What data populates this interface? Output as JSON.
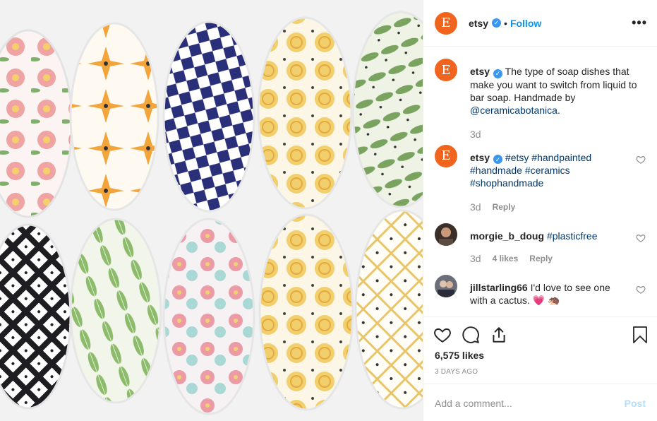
{
  "post": {
    "author": "etsy",
    "avatar_letter": "E",
    "follow_label": "Follow",
    "separator": "•",
    "verified_glyph": "✓"
  },
  "comments": [
    {
      "user": "etsy",
      "avatar_letter": "E",
      "text_plain": "The type of soap dishes that make you want to switch from liquid to bar soap. Handmade by",
      "mention": "@ceramicabotanica",
      "suffix": ".",
      "time": "3d"
    },
    {
      "user": "etsy",
      "avatar_letter": "E",
      "tags": [
        "#etsy",
        "#handpainted",
        "#handmade",
        "#ceramics",
        "#shophandmade"
      ],
      "time": "3d",
      "reply": "Reply"
    },
    {
      "user": "morgie_b_doug",
      "tags": [
        "#plasticfree"
      ],
      "time": "3d",
      "likes": "4 likes",
      "reply": "Reply"
    },
    {
      "user": "jillstarling66",
      "text_plain": "I'd love to see one with a cactus.",
      "emoji": "💗 🦔"
    }
  ],
  "footer": {
    "likes": "6,575 likes",
    "date": "3 DAYS AGO",
    "comment_placeholder": "Add a comment...",
    "post_label": "Post"
  },
  "colors": {
    "etsy_orange": "#f1641e",
    "link_blue": "#0095f6",
    "hashtag_blue": "#00376b",
    "muted": "#8e8e8e"
  },
  "icons": [
    "more-options-icon",
    "verified-badge-icon",
    "heart-icon",
    "comment-icon",
    "share-icon",
    "bookmark-icon"
  ]
}
